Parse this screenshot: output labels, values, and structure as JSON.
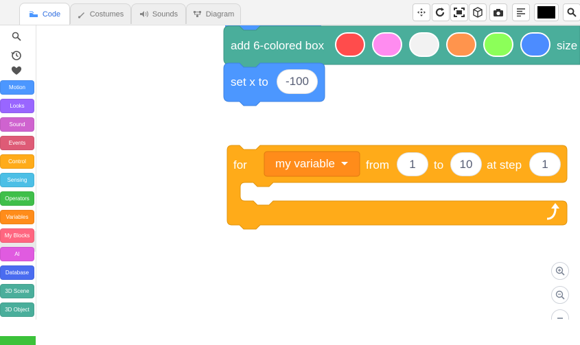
{
  "tabs": [
    {
      "label": "Code",
      "icon": "code-icon",
      "active": true
    },
    {
      "label": "Costumes",
      "icon": "brush-icon",
      "active": false
    },
    {
      "label": "Sounds",
      "icon": "speaker-icon",
      "active": false
    },
    {
      "label": "Diagram",
      "icon": "diagram-icon",
      "active": false
    }
  ],
  "toolbar": {
    "buttons": [
      "move-icon",
      "rotate-icon",
      "fit-screen-icon",
      "cube-icon",
      "camera-icon",
      "align-icon",
      "search-icon"
    ],
    "color_swatch": "#000000"
  },
  "sidebar": {
    "icons": [
      "search-icon",
      "history-icon",
      "heart-icon"
    ],
    "categories": [
      {
        "label": "Motion",
        "color": "#4c97ff"
      },
      {
        "label": "Looks",
        "color": "#9966ff"
      },
      {
        "label": "Sound",
        "color": "#cf63cf"
      },
      {
        "label": "Events",
        "color": "#de5b76"
      },
      {
        "label": "Control",
        "color": "#ffab19"
      },
      {
        "label": "Sensing",
        "color": "#4cbfe6"
      },
      {
        "label": "Operators",
        "color": "#40bf4a"
      },
      {
        "label": "Variables",
        "color": "#ff8c1a"
      },
      {
        "label": "My Blocks",
        "color": "#ff6680"
      },
      {
        "label": "AI",
        "color": "#e05be0"
      },
      {
        "label": "Database",
        "color": "#4a6cf0"
      },
      {
        "label": "3D Scene",
        "color": "#4aae9b"
      },
      {
        "label": "3D Object",
        "color": "#4aae9b"
      }
    ]
  },
  "blocks": {
    "add_box": {
      "label": "add 6-colored box",
      "colors": [
        "#ff4c4c",
        "#ff8cf0",
        "#f2f2f2",
        "#ff944d",
        "#8cff59",
        "#4c8cff"
      ],
      "trailing": "size",
      "color": "#4aae9b"
    },
    "set_x": {
      "label": "set x to",
      "value": "-100",
      "color": "#4c97ff"
    },
    "for_loop": {
      "for": "for",
      "variable": "my variable",
      "from": "from",
      "from_value": "1",
      "to": "to",
      "to_value": "10",
      "at_step": "at step",
      "step_value": "1",
      "color": "#ffab19"
    }
  },
  "zoom": [
    "zoom-in-icon",
    "zoom-out-icon",
    "zoom-reset-icon"
  ]
}
